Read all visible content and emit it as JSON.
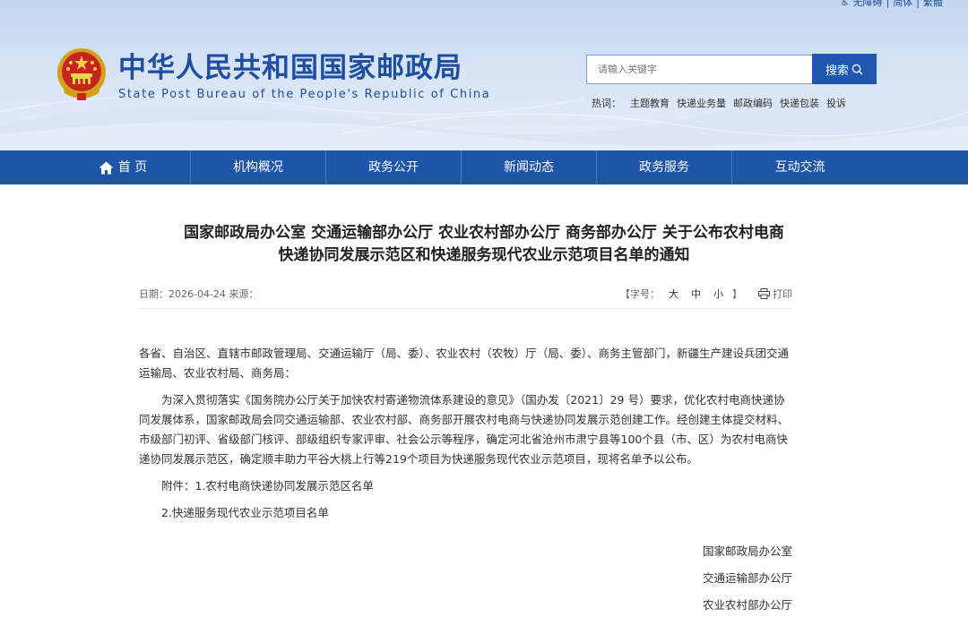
{
  "header": {
    "top_links": [
      "无障碍",
      "简体",
      "繁體"
    ],
    "title_cn": "中华人民共和国国家邮政局",
    "title_en": "State Post Bureau of the People's Republic of China",
    "search": {
      "placeholder": "请输入关键字",
      "button_label": "搜索"
    },
    "hot_label": "热词：",
    "hot_words": [
      "主题教育",
      "快递业务量",
      "邮政编码",
      "快递包装",
      "投诉"
    ]
  },
  "nav": {
    "items": [
      "首 页",
      "机构概况",
      "政务公开",
      "新闻动态",
      "政务服务",
      "互动交流"
    ]
  },
  "article": {
    "title_line1": "国家邮政局办公室 交通运输部办公厅 农业农村部办公厅 商务部办公厅 关于公布农村电商",
    "title_line2": "快递协同发展示范区和快递服务现代农业示范项目名单的通知",
    "date": "日期：2026-04-24 来源：",
    "font_label": "【字号：",
    "font_sizes": [
      "大",
      "中",
      "小"
    ],
    "font_close": "】",
    "print_label": "打印",
    "para_salutation": "各省、自治区、直辖市邮政管理局、交通运输厅（局、委）、农业农村（农牧）厅（局、委）、商务主管部门，新疆生产建设兵团交通运输局、农业农村局、商务局：",
    "para_body": "为深入贯彻落实《国务院办公厅关于加快农村寄递物流体系建设的意见》（国办发〔2021〕29 号）要求，优化农村电商快递协同发展体系，国家邮政局会同交通运输部、农业农村部、商务部开展农村电商与快递协同发展示范创建工作。经创建主体提交材料、市级部门初评、省级部门核评、部级组织专家评审、社会公示等程序，确定河北省沧州市肃宁县等100个县（市、区）为农村电商快递协同发展示范区，确定顺丰助力平谷大桃上行等219个项目为快递服务现代农业示范项目，现将名单予以公布。",
    "attachment_1": "附件：1.农村电商快递协同发展示范区名单",
    "attachment_2": "2.快递服务现代农业示范项目名单",
    "signatures": [
      "国家邮政局办公室",
      "交通运输部办公厅",
      "农业农村部办公厅"
    ]
  },
  "colors": {
    "brand_blue": "#1d55a8",
    "title_blue": "#1f4ea1"
  }
}
